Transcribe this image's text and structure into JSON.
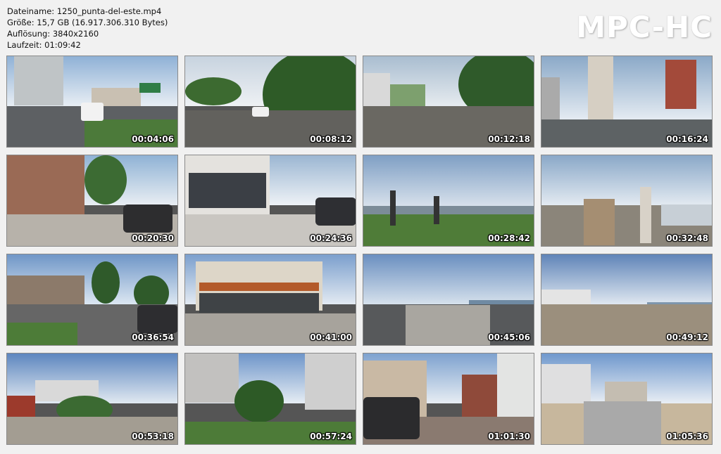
{
  "info": {
    "filename_line": "Dateiname: 1250_punta-del-este.mp4",
    "size_line": "Größe: 15,7 GB (16.917.306.310 Bytes)",
    "resolution_line": "Auflösung: 3840x2160",
    "duration_line": "Laufzeit: 01:09:42"
  },
  "brand": "MPC-HC",
  "thumbnails": [
    {
      "timestamp": "00:04:06"
    },
    {
      "timestamp": "00:08:12"
    },
    {
      "timestamp": "00:12:18"
    },
    {
      "timestamp": "00:16:24"
    },
    {
      "timestamp": "00:20:30"
    },
    {
      "timestamp": "00:24:36"
    },
    {
      "timestamp": "00:28:42"
    },
    {
      "timestamp": "00:32:48"
    },
    {
      "timestamp": "00:36:54"
    },
    {
      "timestamp": "00:41:00"
    },
    {
      "timestamp": "00:45:06"
    },
    {
      "timestamp": "00:49:12"
    },
    {
      "timestamp": "00:53:18"
    },
    {
      "timestamp": "00:57:24"
    },
    {
      "timestamp": "01:01:30"
    },
    {
      "timestamp": "01:05:36"
    }
  ],
  "colors": {
    "sky": "#9fb6cf",
    "sky_cloud": "#dfe6ee",
    "road": "#5a5d60",
    "grass": "#4f7a3a",
    "tree": "#2f5a2a",
    "building": "#b9b4ac",
    "ocean": "#6f8ea8",
    "sand": "#b7a58e"
  }
}
